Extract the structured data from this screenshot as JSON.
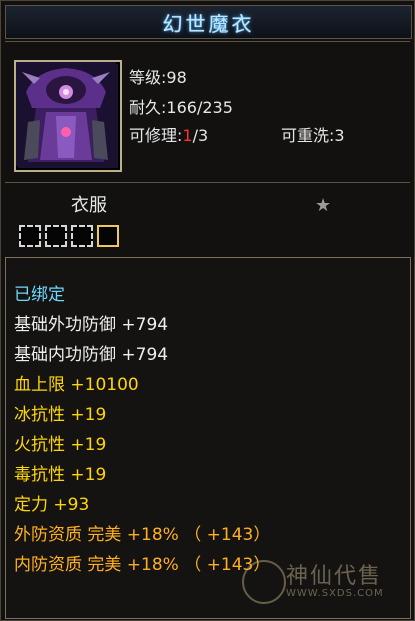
{
  "item": {
    "name": "幻世魔衣",
    "stats": {
      "level_label": "等级",
      "level_value": ":98",
      "durability_label": "耐久",
      "durability_value": ":166/235",
      "repair_label": "可修理",
      "repair_colon": ":",
      "repair_current": "1",
      "repair_total": "/3",
      "rewash_label": "可重洗",
      "rewash_value": ":3"
    },
    "category": "衣服",
    "star_glyph": "★",
    "slots": 4,
    "active_slot_index": 3
  },
  "attributes": {
    "bound": "已绑定",
    "lines": [
      {
        "text": "基础外功防御  +794",
        "color": "#efefef"
      },
      {
        "text": "基础内功防御  +794",
        "color": "#efefef"
      },
      {
        "text": "血上限  +10100",
        "color": "#ffd700"
      },
      {
        "text": "冰抗性  +19",
        "color": "#ffd700"
      },
      {
        "text": "火抗性  +19",
        "color": "#ffd700"
      },
      {
        "text": "毒抗性  +19",
        "color": "#ffd700"
      },
      {
        "text": "定力  +93",
        "color": "#ffd700"
      },
      {
        "text": "外防资质    完美  +18% （ +143）",
        "color": "#ffb020"
      },
      {
        "text": "内防资质    完美  +18% （ +143）",
        "color": "#ffb020"
      }
    ]
  },
  "watermark": {
    "brand": "神仙代售",
    "url": "WWW.SXDS.COM"
  },
  "colors": {
    "title": "#b6e8ff",
    "bound": "#6ad9ff",
    "yellow": "#ffd700",
    "orange": "#ffb020",
    "red": "#ff3030"
  }
}
